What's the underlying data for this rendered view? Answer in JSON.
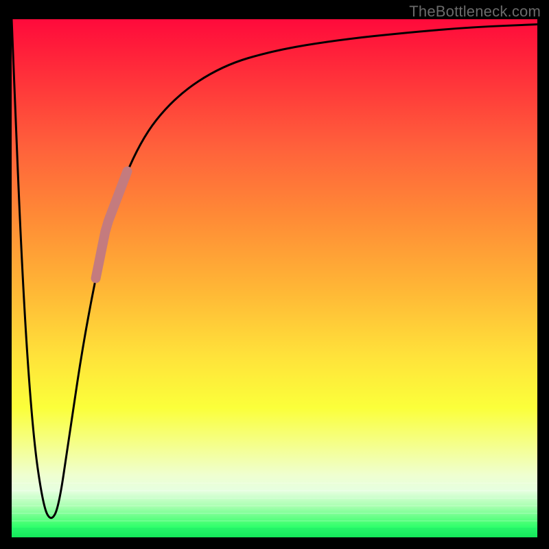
{
  "watermark": "TheBottleneck.com",
  "colors": {
    "frame": "#000000",
    "watermark_text": "#6b6b6b",
    "curve": "#000000",
    "highlight": "#c47b7e"
  },
  "chart_data": {
    "type": "line",
    "title": "",
    "xlabel": "",
    "ylabel": "",
    "xlim": [
      0,
      100
    ],
    "ylim": [
      0,
      100
    ],
    "grid": false,
    "series": [
      {
        "name": "bottleneck-curve",
        "x": [
          0,
          2,
          4,
          6,
          7.5,
          9,
          11,
          14,
          18,
          24,
          31,
          40,
          50,
          62,
          76,
          88,
          100
        ],
        "values": [
          100,
          50,
          20,
          6,
          3,
          6,
          20,
          40,
          60,
          76,
          85,
          91,
          94,
          96,
          97.5,
          98.5,
          99
        ]
      }
    ],
    "highlight_segment": {
      "series": "bottleneck-curve",
      "x_start": 16,
      "x_end": 22
    },
    "background_gradient": {
      "stops": [
        {
          "pos": 0.0,
          "color": "#ff0a3b"
        },
        {
          "pos": 0.25,
          "color": "#ff623b"
        },
        {
          "pos": 0.52,
          "color": "#ffb636"
        },
        {
          "pos": 0.75,
          "color": "#fbff3a"
        },
        {
          "pos": 0.97,
          "color": "#4cff77"
        },
        {
          "pos": 1.0,
          "color": "#0aef59"
        }
      ]
    }
  }
}
